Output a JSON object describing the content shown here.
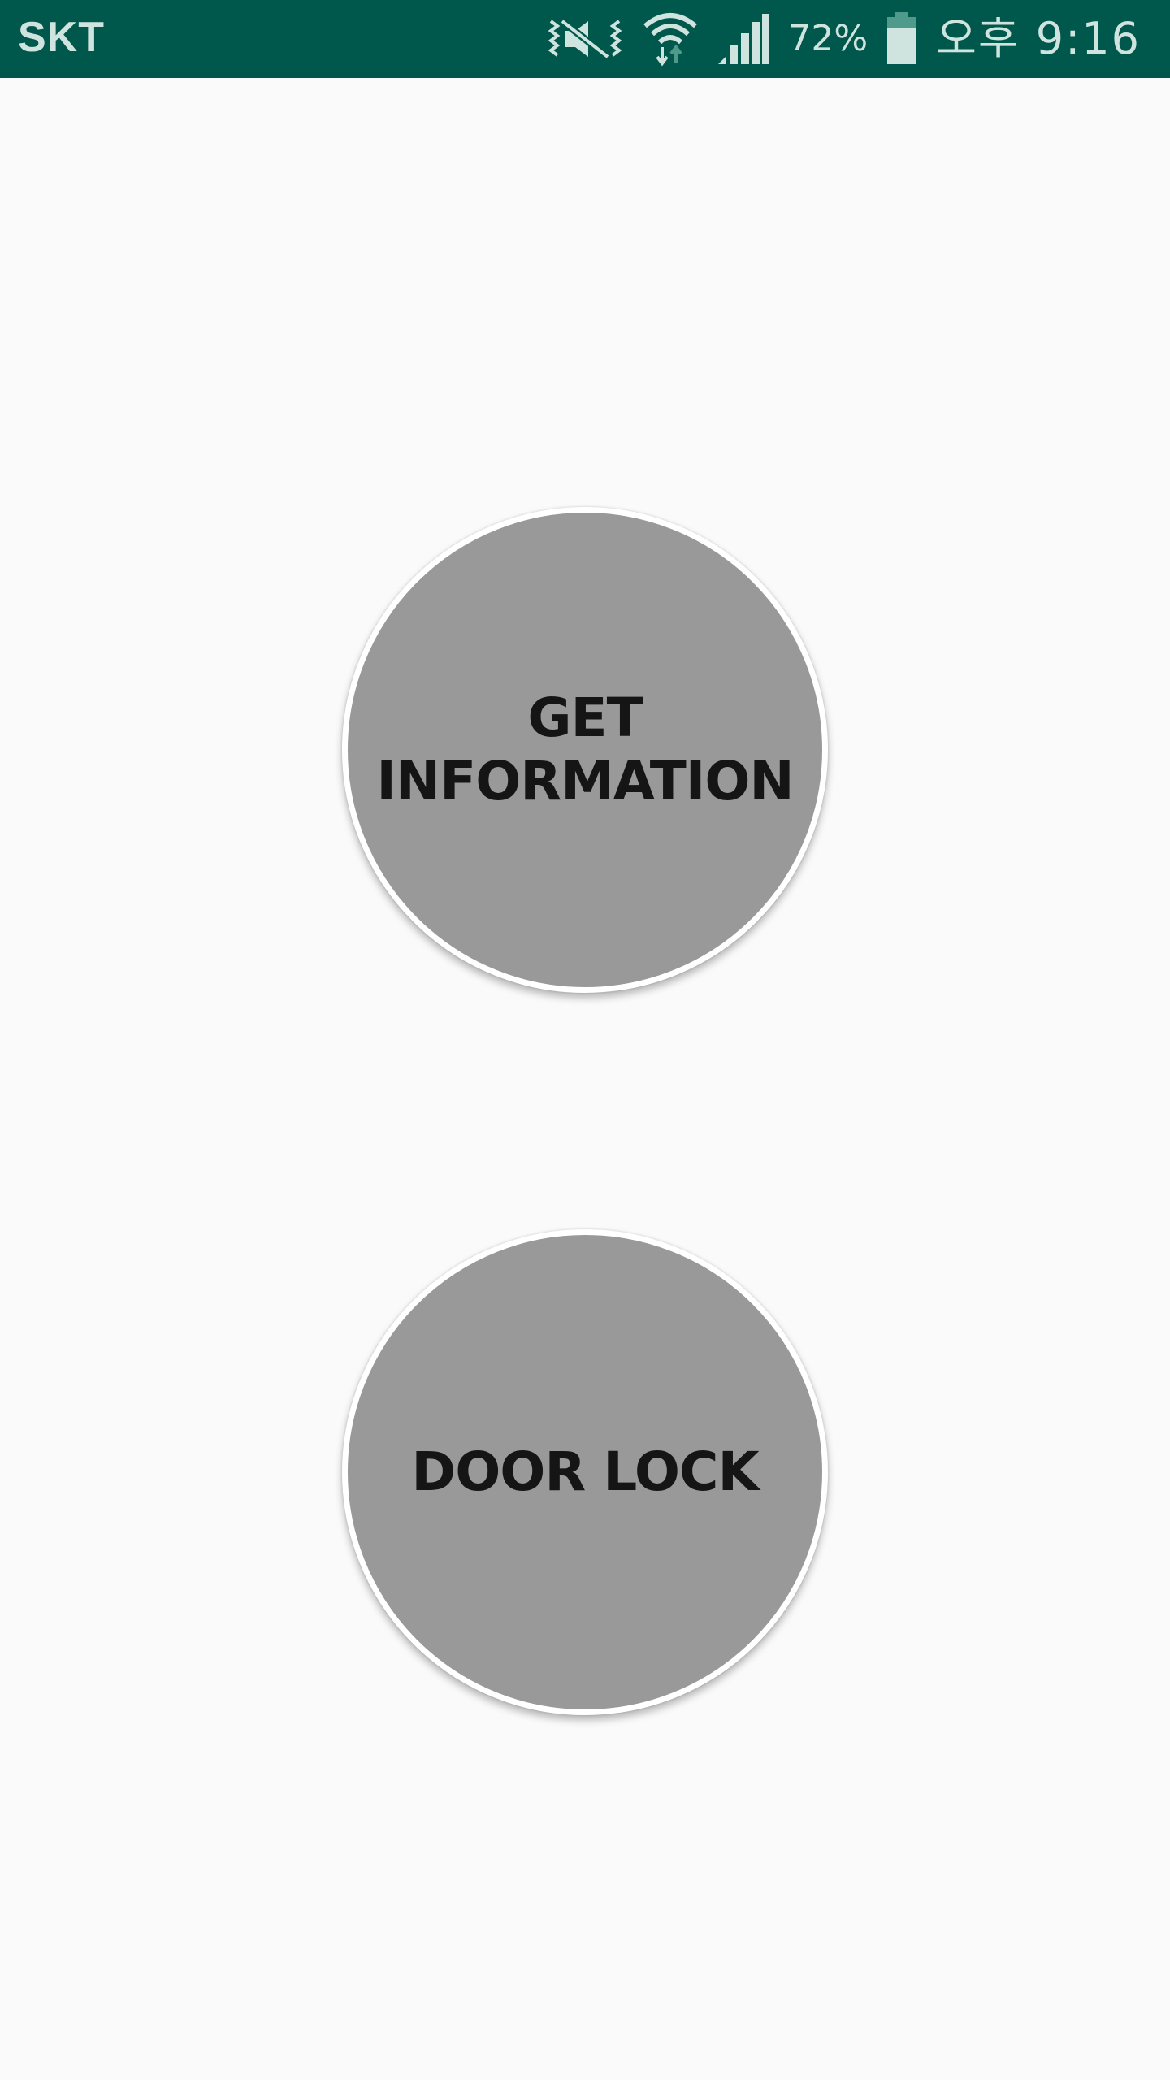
{
  "status_bar": {
    "carrier": "SKT",
    "icons": [
      "vibrate-off-icon",
      "wifi-icon",
      "cell-signal-icon",
      "battery-icon"
    ],
    "battery_percent": "72%",
    "time": "오후 9:16",
    "background_color": "#00574b"
  },
  "main": {
    "buttons": [
      {
        "label_line1": "GET",
        "label_line2": "INFORMATION"
      },
      {
        "label": "DOOR LOCK"
      }
    ],
    "button_color": "#999999",
    "background_color": "#fafafa"
  }
}
